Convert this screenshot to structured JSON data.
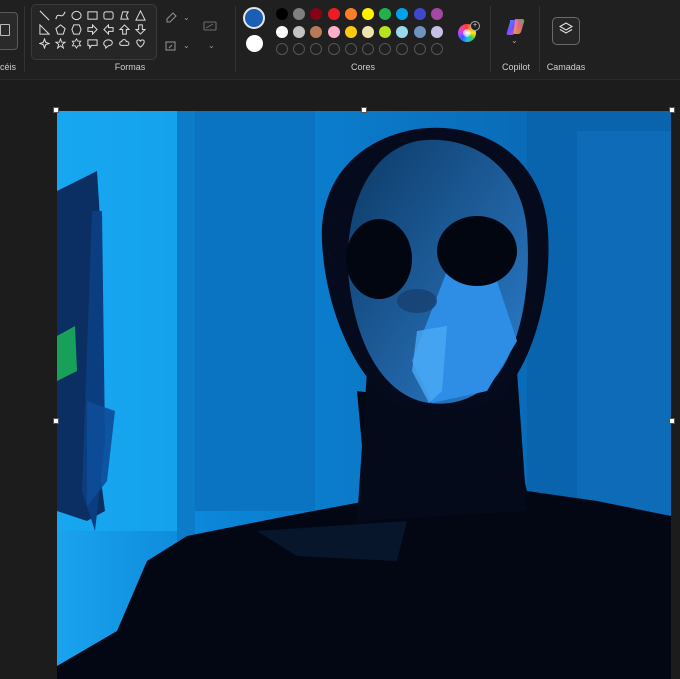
{
  "ribbon": {
    "groups": {
      "brushes_label": "céis",
      "shapes_label": "Formas",
      "colors_label": "Cores",
      "copilot_label": "Copilot",
      "layers_label": "Camadas"
    }
  },
  "shapes": {
    "items": [
      "line-icon",
      "curve-icon",
      "oval-icon",
      "rectangle-icon",
      "rounded-rectangle-icon",
      "polygon-icon",
      "triangle-icon",
      "right-triangle-icon",
      "pentagon-icon",
      "hexagon-icon",
      "right-arrow-icon",
      "left-arrow-icon",
      "up-arrow-icon",
      "down-arrow-icon",
      "four-point-star-icon",
      "five-point-star-icon",
      "six-point-star-icon",
      "callout-rect-icon",
      "callout-oval-icon",
      "callout-cloud-icon",
      "heart-icon"
    ]
  },
  "colors": {
    "primary": "#1a5fb4",
    "secondary": "#ffffff",
    "row1": [
      "#000000",
      "#7f7f7f",
      "#880015",
      "#ed1c24",
      "#ff7f27",
      "#fff200",
      "#22b14c",
      "#00a2e8",
      "#3f48cc",
      "#a349a4"
    ],
    "row2": [
      "#ffffff",
      "#c3c3c3",
      "#b97a57",
      "#ffaec9",
      "#ffc90e",
      "#efe4b0",
      "#b5e61d",
      "#99d9ea",
      "#7092be",
      "#c8bfe7"
    ],
    "custom_slots": 10
  },
  "canvas": {
    "background_color": "#0a63b0",
    "description_icon": "painted-masked-figure"
  }
}
